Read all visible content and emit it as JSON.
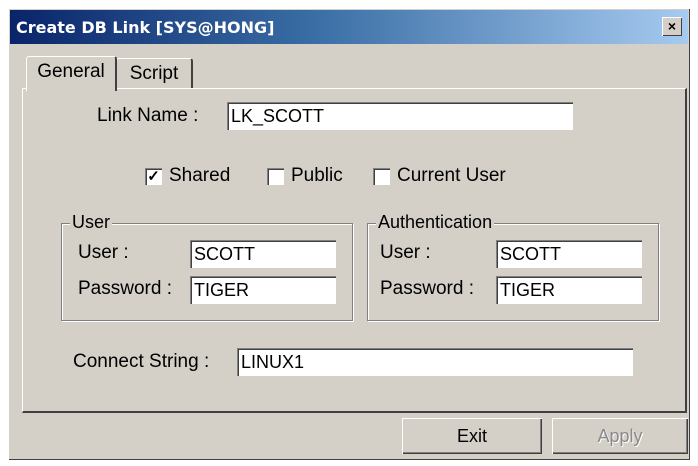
{
  "window": {
    "title": "Create DB Link [SYS@HONG]",
    "close_symbol": "×"
  },
  "tabs": [
    {
      "label": "General"
    },
    {
      "label": "Script"
    }
  ],
  "form": {
    "link_name_label": "Link Name :",
    "link_name_value": "LK_SCOTT",
    "options": [
      {
        "label": "Shared",
        "checked": true,
        "mark": "✓"
      },
      {
        "label": "Public",
        "checked": false
      },
      {
        "label": "Current User",
        "checked": false
      }
    ],
    "user_group": {
      "title": "User",
      "user_label": "User :",
      "user_value": "SCOTT",
      "password_label": "Password :",
      "password_value": "TIGER"
    },
    "auth_group": {
      "title": "Authentication",
      "user_label": "User :",
      "user_value": "SCOTT",
      "password_label": "Password :",
      "password_value": "TIGER"
    },
    "connect_string_label": "Connect String :",
    "connect_string_value": "LINUX1"
  },
  "buttons": {
    "exit": "Exit",
    "apply": "Apply"
  }
}
